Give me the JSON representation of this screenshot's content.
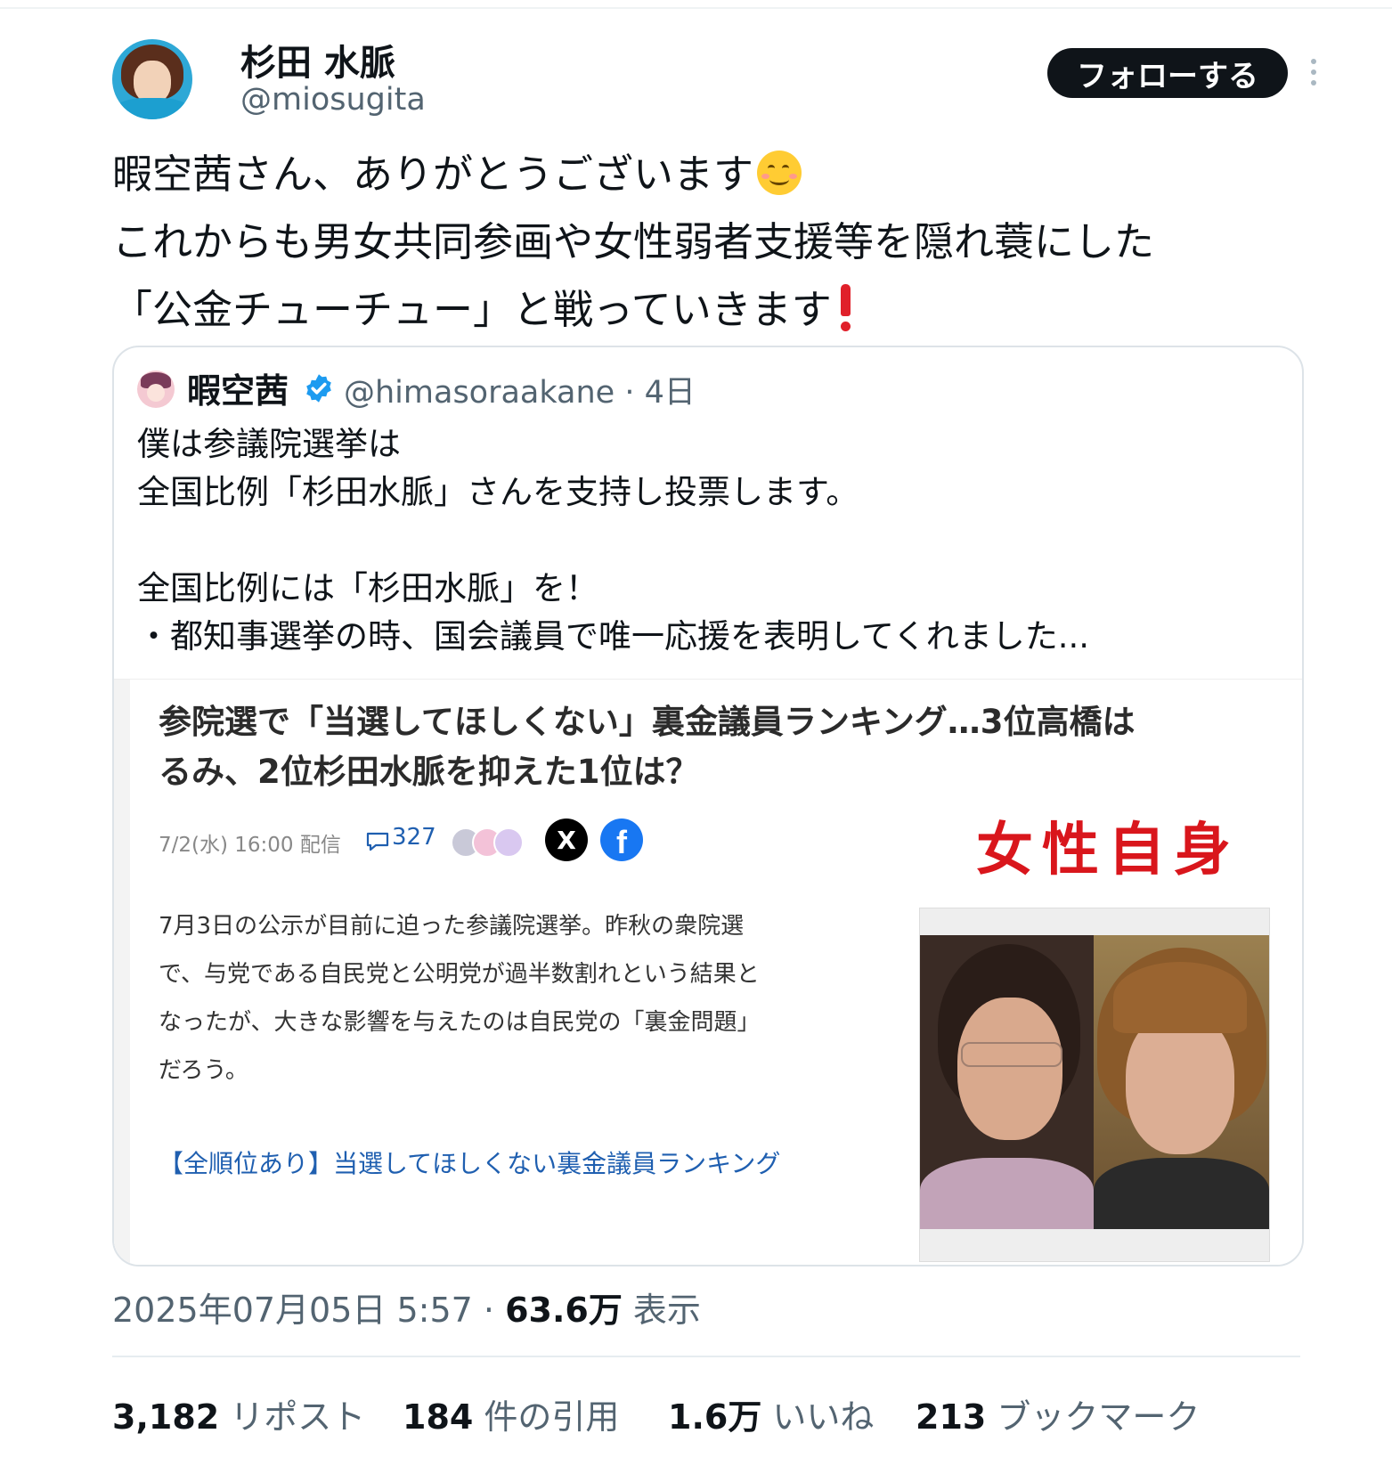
{
  "author": {
    "name": "杉田 水脈",
    "handle": "@miosugita",
    "follow_label": "フォローする"
  },
  "tweet": {
    "lines": [
      "暇空茜さん、ありがとうございます",
      "これからも男女共同参画や女性弱者支援等を隠れ蓑にした",
      "「公金チューチュー」と戦っていきます"
    ],
    "emoji": [
      "smiling-face-emoji",
      "red-exclamation-emoji"
    ]
  },
  "quote": {
    "name": "暇空茜",
    "verified": true,
    "handle_time": "@himasoraakane · 4日",
    "lines": [
      "僕は参議院選挙は",
      "全国比例「杉田水脈」さんを支持し投票します。",
      "",
      "全国比例には「杉田水脈」を！",
      "・都知事選挙の時、国会議員で唯一応援を表明してくれました..."
    ],
    "article": {
      "title_lines": [
        "参院選で「当選してほしくない」裏金議員ランキング…3位高橋は",
        "るみ、2位杉田水脈を抑えた1位は？"
      ],
      "date": "7/2(水) 16:00 配信",
      "comment_count": "327",
      "share_x": "X",
      "share_fb": "f",
      "publisher": "女性自身",
      "body_lines": [
        "7月3日の公示が目前に迫った参議院選挙。昨秋の衆院選",
        "で、与党である自民党と公明党が過半数割れという結果と",
        "なったが、大きな影響を与えたのは自民党の「裏金問題」",
        "だろう。"
      ],
      "link": "【全順位あり】当選してほしくない裏金議員ランキング"
    }
  },
  "meta": {
    "datetime": "2025年07月05日 5:57 · ",
    "views": "63.6万",
    "views_label": " 表示"
  },
  "stats": {
    "reposts": {
      "num": "3,182",
      "label": " リポスト"
    },
    "quotes": {
      "num": "184",
      "label": " 件の引用"
    },
    "likes": {
      "num": "1.6万",
      "label": " いいね"
    },
    "bookmarks": {
      "num": "213",
      "label": " ブックマーク"
    }
  },
  "colors": {
    "text": "#0f1419",
    "secondary": "#536471",
    "verified": "#1d9bf0",
    "link": "#1f5fb0",
    "publisher": "#d9161c"
  }
}
